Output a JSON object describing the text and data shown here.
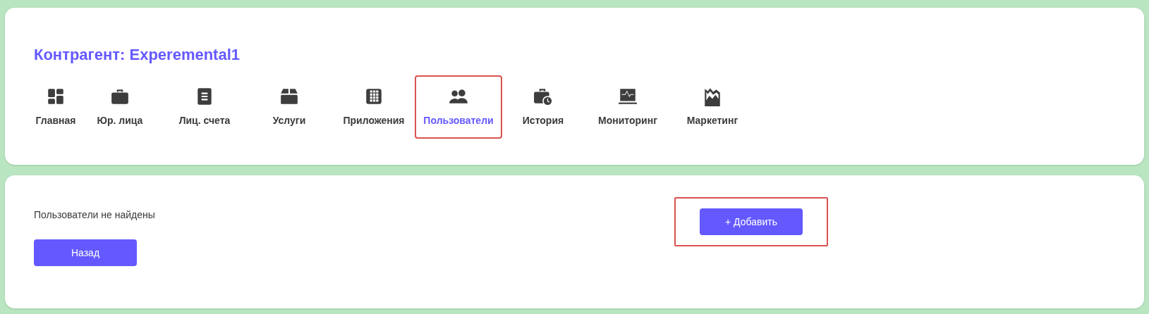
{
  "header": {
    "title": "Контрагент: Experemental1"
  },
  "tabs": [
    {
      "label": "Главная",
      "kind": "dashboard",
      "selected": false,
      "highlighted": false
    },
    {
      "label": "Юр. лица",
      "kind": "briefcase",
      "selected": false,
      "highlighted": false
    },
    {
      "label": "Лиц. счета",
      "kind": "document",
      "selected": false,
      "highlighted": false
    },
    {
      "label": "Услуги",
      "kind": "box",
      "selected": false,
      "highlighted": false
    },
    {
      "label": "Приложения",
      "kind": "grid",
      "selected": false,
      "highlighted": false
    },
    {
      "label": "Пользователи",
      "kind": "users",
      "selected": true,
      "highlighted": true
    },
    {
      "label": "История",
      "kind": "history",
      "selected": false,
      "highlighted": false
    },
    {
      "label": "Мониторинг",
      "kind": "monitor",
      "selected": false,
      "highlighted": false
    },
    {
      "label": "Маркетинг",
      "kind": "chart",
      "selected": false,
      "highlighted": false
    }
  ],
  "content": {
    "message": "Пользователи не найдены",
    "back_button": "Назад",
    "add_button": {
      "label": "+ Добавить",
      "highlighted": true
    }
  }
}
